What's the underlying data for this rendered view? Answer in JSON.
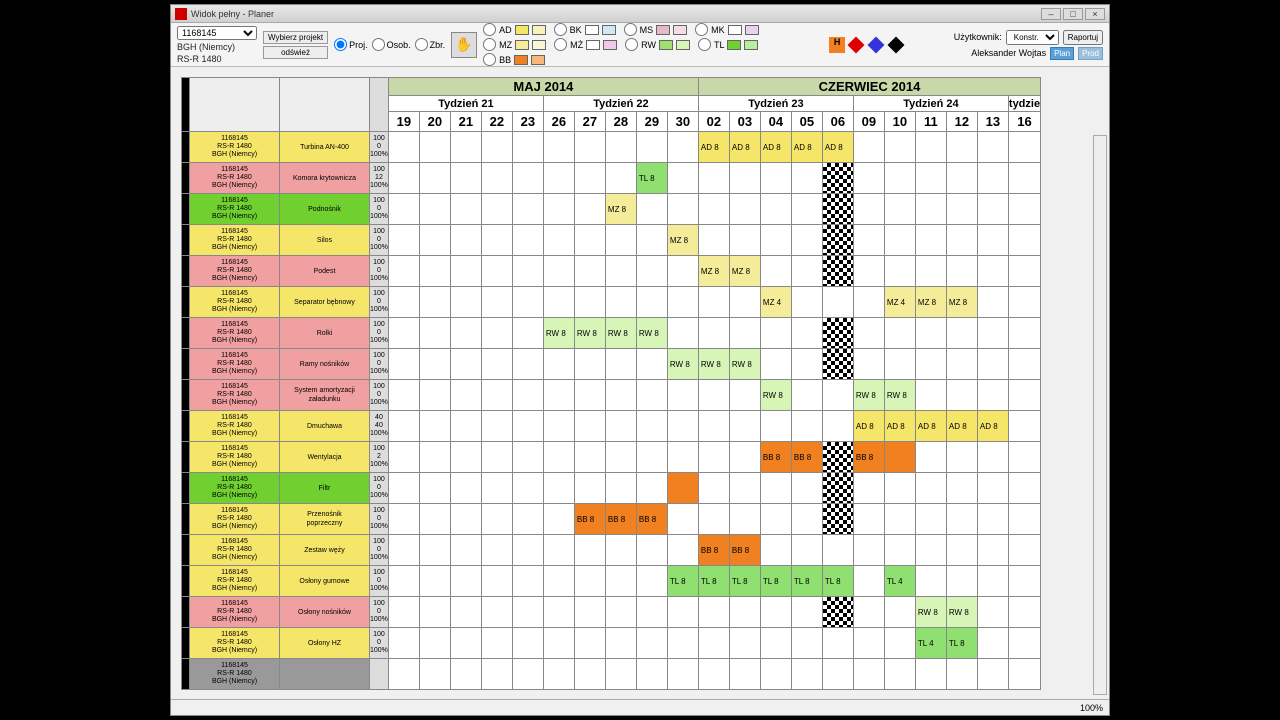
{
  "title": "Widok pełny - Planer",
  "project_code": "1168145",
  "project_lines": [
    "BGH (Niemcy)",
    "RS-R 1480"
  ],
  "btn_wyb": "Wybierz projekt",
  "btn_odsw": "odśwież",
  "mode": {
    "proj": "Proj.",
    "osob": "Osob.",
    "zbr": "Zbr."
  },
  "legend": [
    {
      "k": "AD",
      "c1": "#f5e66a",
      "c2": "#f9f3bb"
    },
    {
      "k": "BK",
      "c2": "#cfe8f5"
    },
    {
      "k": "MS",
      "c1": "#e8b8c8",
      "c2": "#f5dde5"
    },
    {
      "k": "MK",
      "c2": "#e5d5f0"
    },
    {
      "k": "MZ",
      "c1": "#f5ec9a",
      "c2": "#faf6d5"
    },
    {
      "k": "MŻ",
      "c2": "#f0c8e8"
    },
    {
      "k": "RW",
      "c1": "#9fe070",
      "c2": "#d8f5b8"
    },
    {
      "k": "TL",
      "c1": "#6fd030",
      "c2": "#b8eea0"
    },
    {
      "k": "BB",
      "c1": "#f08020",
      "c2": "#f8b878"
    }
  ],
  "user_label": "Użytkownik:",
  "user_select": "Konstr.",
  "user_btn": "Raportuj",
  "user_name": "Aleksander Wojtas",
  "btn_plan": "Plan",
  "btn_prod": "Prod",
  "months": [
    {
      "label": "MAJ 2014",
      "span": 10
    },
    {
      "label": "CZERWIEC 2014",
      "span": 12
    }
  ],
  "weeks": [
    {
      "label": "Tydzień 21",
      "span": 5
    },
    {
      "label": "Tydzień 22",
      "span": 5
    },
    {
      "label": "Tydzień 23",
      "span": 5
    },
    {
      "label": "Tydzień 24",
      "span": 5
    },
    {
      "label": "tydzie",
      "span": 2
    }
  ],
  "days": [
    "19",
    "20",
    "21",
    "22",
    "23",
    "26",
    "27",
    "28",
    "29",
    "30",
    "02",
    "03",
    "04",
    "05",
    "06",
    "09",
    "10",
    "11",
    "12",
    "13",
    "16"
  ],
  "proj_info": [
    "1168145",
    "RS-R 1480",
    "BGH (Niemcy)"
  ],
  "rows": [
    {
      "c": "yellow",
      "name": "Turbina AN-400",
      "n": [
        "100",
        "0",
        "100%"
      ],
      "cells": {
        "10": {
          "t": "AD 8",
          "cl": "c-ad"
        },
        "11": {
          "t": "AD 8",
          "cl": "c-ad"
        },
        "12": {
          "t": "AD 8",
          "cl": "c-ad"
        },
        "13": {
          "t": "AD 8",
          "cl": "c-ad"
        },
        "14": {
          "t": "AD 8",
          "cl": "c-ad"
        }
      }
    },
    {
      "c": "pink",
      "name": "Komora krytownicza",
      "n": [
        "100",
        "12",
        "100%"
      ],
      "cells": {
        "8": {
          "t": "TL 8",
          "cl": "c-tl"
        },
        "14": {
          "flag": true
        }
      }
    },
    {
      "c": "green",
      "name": "Podnośnik",
      "n": [
        "100",
        "0",
        "100%"
      ],
      "cells": {
        "7": {
          "t": "MZ 8",
          "cl": "c-mz"
        },
        "14": {
          "flag": true
        }
      }
    },
    {
      "c": "yellow",
      "name": "Silos",
      "n": [
        "100",
        "0",
        "100%"
      ],
      "cells": {
        "9": {
          "t": "MZ 8",
          "cl": "c-mz"
        },
        "14": {
          "flag": true
        }
      }
    },
    {
      "c": "pink",
      "name": "Podest",
      "n": [
        "100",
        "0",
        "100%"
      ],
      "cells": {
        "10": {
          "t": "MZ 8",
          "cl": "c-mz"
        },
        "11": {
          "t": "MZ 8",
          "cl": "c-mz"
        },
        "14": {
          "flag": true
        }
      }
    },
    {
      "c": "yellow",
      "name": "Separator bębnowy",
      "n": [
        "100",
        "0",
        "100%"
      ],
      "cells": {
        "12": {
          "t": "MZ 4",
          "cl": "c-mz"
        },
        "15": {
          "crack": true
        },
        "16": {
          "t": "MZ 4",
          "cl": "c-mz"
        },
        "17": {
          "t": "MZ 8",
          "cl": "c-mz"
        },
        "18": {
          "t": "MZ 8",
          "cl": "c-mz"
        }
      }
    },
    {
      "c": "pink",
      "name": "Rolki",
      "n": [
        "100",
        "0",
        "100%"
      ],
      "cells": {
        "5": {
          "t": "RW 8",
          "cl": "c-rw"
        },
        "6": {
          "t": "RW 8",
          "cl": "c-rw"
        },
        "7": {
          "t": "RW 8",
          "cl": "c-rw"
        },
        "8": {
          "t": "RW 8",
          "cl": "c-rw"
        },
        "14": {
          "flag": true
        }
      }
    },
    {
      "c": "pink",
      "name": "Ramy nośników",
      "n": [
        "100",
        "0",
        "100%"
      ],
      "cells": {
        "9": {
          "t": "RW 8",
          "cl": "c-rw"
        },
        "10": {
          "t": "RW 8",
          "cl": "c-rw"
        },
        "11": {
          "t": "RW 8",
          "cl": "c-rw"
        },
        "14": {
          "flag": true
        }
      }
    },
    {
      "c": "pink",
      "name": "System amortyzacji\\nzaładunku",
      "n": [
        "100",
        "0",
        "100%"
      ],
      "cells": {
        "12": {
          "t": "RW 8",
          "cl": "c-rw"
        },
        "13": {
          "crack": true
        },
        "14": {
          "crack": true
        },
        "15": {
          "t": "RW 8",
          "cl": "c-rw"
        },
        "16": {
          "t": "RW 8",
          "cl": "c-rw"
        }
      }
    },
    {
      "c": "yellow",
      "name": "Dmuchawa",
      "n": [
        "40",
        "40",
        "100%"
      ],
      "cells": {
        "15": {
          "t": "AD 8",
          "cl": "c-ad"
        },
        "16": {
          "t": "AD 8",
          "cl": "c-ad"
        },
        "17": {
          "t": "AD 8",
          "cl": "c-ad"
        },
        "18": {
          "t": "AD 8",
          "cl": "c-ad"
        },
        "19": {
          "t": "AD 8",
          "cl": "c-ad"
        }
      }
    },
    {
      "c": "yellow",
      "name": "Wentylacja",
      "n": [
        "100",
        "2",
        "100%"
      ],
      "cells": {
        "12": {
          "t": "BB 8",
          "cl": "c-bb"
        },
        "13": {
          "t": "BB 8",
          "cl": "c-bb"
        },
        "14": {
          "flag": true
        },
        "15": {
          "t": "BB 8",
          "cl": "c-bb"
        },
        "16": {
          "t": "",
          "cl": "c-bb"
        }
      }
    },
    {
      "c": "green",
      "name": "Filtr",
      "n": [
        "100",
        "0",
        "100%"
      ],
      "cells": {
        "9": {
          "t": "",
          "cl": "c-bb"
        },
        "14": {
          "flag": true
        }
      }
    },
    {
      "c": "yellow",
      "name": "Przenośnik\\npoprzeczny",
      "n": [
        "100",
        "0",
        "100%"
      ],
      "cells": {
        "6": {
          "t": "BB 8",
          "cl": "c-bb"
        },
        "7": {
          "t": "BB 8",
          "cl": "c-bb"
        },
        "8": {
          "t": "BB 8",
          "cl": "c-bb"
        },
        "14": {
          "flag": true
        }
      }
    },
    {
      "c": "yellow",
      "name": "Zestaw węży",
      "n": [
        "100",
        "0",
        "100%"
      ],
      "cells": {
        "10": {
          "t": "BB 8",
          "cl": "c-bb"
        },
        "11": {
          "t": "BB 8",
          "cl": "c-bb"
        }
      }
    },
    {
      "c": "yellow",
      "name": "Osłony gumowe",
      "n": [
        "100",
        "0",
        "100%"
      ],
      "cells": {
        "9": {
          "t": "TL 8",
          "cl": "c-tl"
        },
        "10": {
          "t": "TL 8",
          "cl": "c-tl"
        },
        "11": {
          "t": "TL 8",
          "cl": "c-tl"
        },
        "12": {
          "t": "TL 8",
          "cl": "c-tl"
        },
        "13": {
          "t": "TL 8",
          "cl": "c-tl"
        },
        "14": {
          "t": "TL 8",
          "cl": "c-tl"
        },
        "16": {
          "t": "TL 4",
          "cl": "c-tl"
        }
      }
    },
    {
      "c": "pink",
      "name": "Osłony nośników",
      "n": [
        "100",
        "0",
        "100%"
      ],
      "cells": {
        "14": {
          "flag": true
        },
        "17": {
          "t": "RW 8",
          "cl": "c-rw"
        },
        "18": {
          "t": "RW 8",
          "cl": "c-rw"
        }
      }
    },
    {
      "c": "yellow",
      "name": "Osłony HZ",
      "n": [
        "100",
        "0",
        "100%"
      ],
      "cells": {
        "15": {
          "crack": true
        },
        "16": {
          "crack": true
        },
        "17": {
          "t": "TL 4",
          "cl": "c-tl"
        },
        "18": {
          "t": "TL 8",
          "cl": "c-tl"
        }
      }
    },
    {
      "c": "gray",
      "name": "",
      "n": [
        "",
        "",
        ""
      ],
      "cells": {}
    }
  ],
  "zoom": "100%"
}
